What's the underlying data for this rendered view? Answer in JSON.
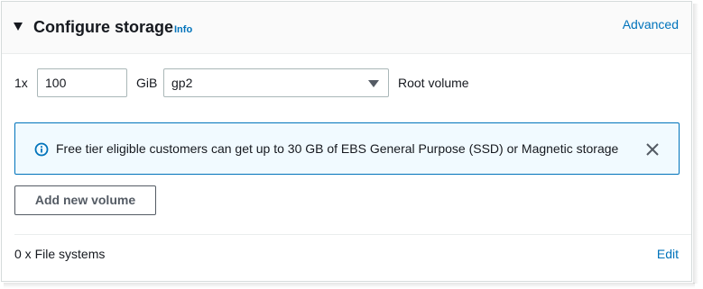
{
  "header": {
    "title": "Configure storage",
    "info_link": "Info",
    "advanced_link": "Advanced"
  },
  "volume": {
    "count_prefix": "1x",
    "size_value": "100",
    "size_unit": "GiB",
    "type_selected": "gp2",
    "role_label": "Root volume"
  },
  "alert": {
    "message": "Free tier eligible customers can get up to 30 GB of EBS General Purpose (SSD) or Magnetic storage",
    "icon": "info-circle-icon",
    "close_icon": "close-icon"
  },
  "actions": {
    "add_volume_label": "Add new volume"
  },
  "file_systems": {
    "summary": "0 x File systems",
    "edit_link": "Edit"
  },
  "colors": {
    "link": "#0073bb",
    "alert_bg": "#f1faff",
    "alert_border": "#0073bb",
    "text": "#16191f"
  }
}
